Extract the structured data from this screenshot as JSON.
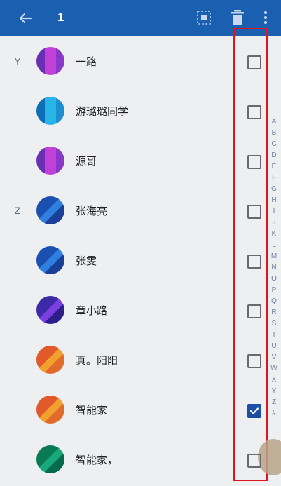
{
  "toolbar": {
    "selected_count": "1",
    "back_icon": "arrow-left-icon",
    "select_all_icon": "select-all-icon",
    "delete_icon": "trash-icon",
    "more_icon": "more-vertical-icon",
    "background": "#1a5fb0"
  },
  "contacts": [
    {
      "section": "Y",
      "name": "一路",
      "checked": false,
      "avatar": "purple-stripe"
    },
    {
      "section": "",
      "name": "游璐璐同学",
      "checked": false,
      "avatar": "blue-stripe"
    },
    {
      "section": "",
      "name": "源哥",
      "checked": false,
      "avatar": "purple-stripe"
    },
    {
      "section": "Z",
      "name": "张海亮",
      "checked": false,
      "avatar": "blue-diagonal"
    },
    {
      "section": "",
      "name": "张雯",
      "checked": false,
      "avatar": "blue-diagonal"
    },
    {
      "section": "",
      "name": "章小路",
      "checked": false,
      "avatar": "violet-diagonal"
    },
    {
      "section": "",
      "name": "真。阳阳",
      "checked": false,
      "avatar": "orange-diagonal"
    },
    {
      "section": "",
      "name": "智能家",
      "checked": true,
      "avatar": "orange-diagonal"
    },
    {
      "section": "",
      "name": "智能家，",
      "checked": false,
      "avatar": "green-diagonal"
    }
  ],
  "alphabet_index": [
    "A",
    "B",
    "C",
    "D",
    "E",
    "F",
    "G",
    "H",
    "I",
    "J",
    "K",
    "L",
    "M",
    "N",
    "O",
    "P",
    "Q",
    "R",
    "S",
    "T",
    "U",
    "V",
    "W",
    "X",
    "Y",
    "Z",
    "#"
  ],
  "colors": {
    "accent": "#1b4fa6",
    "highlight": "#e0141e",
    "background": "#eeeff1"
  }
}
